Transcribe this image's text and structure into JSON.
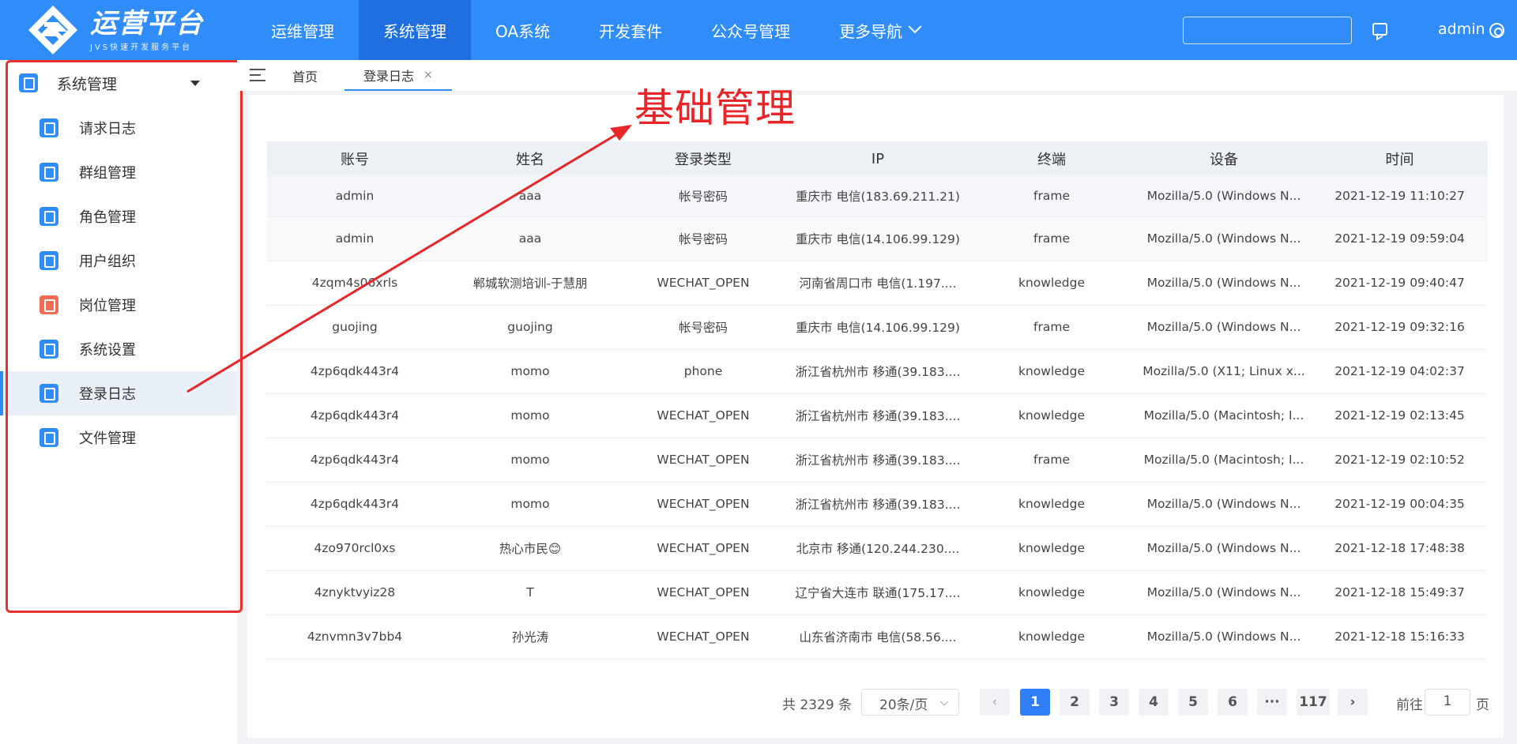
{
  "brand": {
    "title": "运营平台",
    "subtitle": "JVS快速开发服务平台"
  },
  "topnav": {
    "items": [
      "运维管理",
      "系统管理",
      "OA系统",
      "开发套件",
      "公众号管理",
      "更多导航"
    ],
    "user": "admin",
    "search_value": ""
  },
  "sidebar": {
    "section": "系统管理",
    "items": [
      {
        "label": "请求日志",
        "icon": "request-log-icon"
      },
      {
        "label": "群组管理",
        "icon": "group-icon"
      },
      {
        "label": "角色管理",
        "icon": "role-icon"
      },
      {
        "label": "用户组织",
        "icon": "user-org-icon"
      },
      {
        "label": "岗位管理",
        "icon": "position-icon"
      },
      {
        "label": "系统设置",
        "icon": "settings-icon"
      },
      {
        "label": "登录日志",
        "icon": "login-log-icon"
      },
      {
        "label": "文件管理",
        "icon": "file-icon"
      }
    ],
    "active": "登录日志"
  },
  "tabs": {
    "home": "首页",
    "current": "登录日志",
    "close": "×"
  },
  "annotation": {
    "text": "基础管理"
  },
  "table": {
    "headers": [
      "账号",
      "姓名",
      "登录类型",
      "IP",
      "终端",
      "设备",
      "时间"
    ],
    "rows": [
      [
        "admin",
        "aaa",
        "帐号密码",
        "重庆市 电信(183.69.211.21)",
        "frame",
        "Mozilla/5.0 (Windows N...",
        "2021-12-19 11:10:27"
      ],
      [
        "admin",
        "aaa",
        "帐号密码",
        "重庆市 电信(14.106.99.129)",
        "frame",
        "Mozilla/5.0 (Windows N...",
        "2021-12-19 09:59:04"
      ],
      [
        "4zqm4s06xrls",
        "郸城软测培训-于慧朋",
        "WECHAT_OPEN",
        "河南省周口市 电信(1.197....",
        "knowledge",
        "Mozilla/5.0 (Windows N...",
        "2021-12-19 09:40:47"
      ],
      [
        "guojing",
        "guojing",
        "帐号密码",
        "重庆市 电信(14.106.99.129)",
        "frame",
        "Mozilla/5.0 (Windows N...",
        "2021-12-19 09:32:16"
      ],
      [
        "4zp6qdk443r4",
        "momo",
        "phone",
        "浙江省杭州市 移通(39.183....",
        "knowledge",
        "Mozilla/5.0 (X11; Linux x...",
        "2021-12-19 04:02:37"
      ],
      [
        "4zp6qdk443r4",
        "momo",
        "WECHAT_OPEN",
        "浙江省杭州市 移通(39.183....",
        "knowledge",
        "Mozilla/5.0 (Macintosh; I...",
        "2021-12-19 02:13:45"
      ],
      [
        "4zp6qdk443r4",
        "momo",
        "WECHAT_OPEN",
        "浙江省杭州市 移通(39.183....",
        "frame",
        "Mozilla/5.0 (Macintosh; I...",
        "2021-12-19 02:10:52"
      ],
      [
        "4zp6qdk443r4",
        "momo",
        "WECHAT_OPEN",
        "浙江省杭州市 移通(39.183....",
        "knowledge",
        "Mozilla/5.0 (Windows N...",
        "2021-12-19 00:04:35"
      ],
      [
        "4zo970rcl0xs",
        "热心市民😊",
        "WECHAT_OPEN",
        "北京市 移通(120.244.230....",
        "knowledge",
        "Mozilla/5.0 (Windows N...",
        "2021-12-18 17:48:38"
      ],
      [
        "4znyktvyiz28",
        "T",
        "WECHAT_OPEN",
        "辽宁省大连市 联通(175.17....",
        "knowledge",
        "Mozilla/5.0 (Windows N...",
        "2021-12-18 15:49:37"
      ],
      [
        "4znvmn3v7bb4",
        "孙光涛",
        "WECHAT_OPEN",
        "山东省济南市 电信(58.56....",
        "knowledge",
        "Mozilla/5.0 (Windows N...",
        "2021-12-18 15:16:33"
      ]
    ]
  },
  "pagination": {
    "total": "共 2329 条",
    "page_size": "20条/页",
    "pages": [
      "1",
      "2",
      "3",
      "4",
      "5",
      "6",
      "···",
      "117"
    ],
    "current": "1",
    "prev": "‹",
    "next": "›",
    "goto_label": "前往",
    "goto_value": "1",
    "goto_unit": "页"
  },
  "colors": {
    "primary": "#2f8cf8",
    "active_nav": "#1f6fe0",
    "annotation": "#e8262a"
  }
}
